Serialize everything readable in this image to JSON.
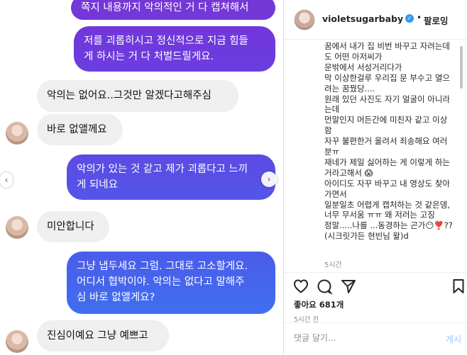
{
  "chat": {
    "messages": [
      {
        "side": "out",
        "lines": [
          "쪽지 내용까지 악의적인 거 다 캡쳐해서"
        ]
      },
      {
        "side": "out",
        "lines": [
          "저를 괴롭히시고 정신적으로 지금 힘들",
          "게 하시는 거 다 처벌드릴게요."
        ]
      },
      {
        "side": "in",
        "lines": [
          "악의는 없어요..그것만 알겠다고해주심"
        ]
      },
      {
        "side": "in",
        "lines": [
          "바로 없앨께요"
        ]
      },
      {
        "side": "out",
        "lines": [
          "악의가 있는 것 같고 제가 괴롭다고 느끼",
          "게 되네요"
        ]
      },
      {
        "side": "in",
        "lines": [
          "미안합니다"
        ]
      },
      {
        "side": "out",
        "lines": [
          "그냥 냅두세요 그럼. 그대로 고소할게요.",
          "어디서 협박이야. 악의는 없다고 말해주",
          "심 바로 없앨게요?"
        ]
      },
      {
        "side": "in",
        "lines": [
          "진심이예요 그냥 예쁘고"
        ]
      }
    ],
    "colors": {
      "gradient_top": "#6a36e0",
      "gradient_bottom": "#3f6ff0",
      "incoming": "#efefef"
    }
  },
  "post": {
    "username": "violetsugarbaby",
    "separator": "•",
    "follow_label": "팔로잉",
    "caption_lines": [
      "꿈에서 내가 집 비번 바꾸고 자려는데",
      "도 어떤 아저씨가",
      "문밖에서 서성거리다가",
      "막 이상한걸루 우리집 문 부수고 열으",
      "려는 꿈꿨당....",
      "원래 있던 사진도 자기 얼굴이 아니라",
      "는데",
      "먼말인지 머든간에 미친자 같고 이상",
      "함",
      "자꾸 불편한거 올려서 죄송해요 여러",
      "분ㅠ",
      "재네가 제일 싫어하는 게 이렇게 하는",
      "거라고해서 😱",
      "아이디도 자꾸 바꾸고 내 영상도 찾아",
      "가면서",
      "일분일초 어렵게 캡처하는 것 같은뎅,",
      "너무 무서움 ㅠㅠ 왜 저러는 고징",
      "정말.....나를 ...동경하는 곤가😶❣️??",
      "(시크릿가든 현빈님 왈)d"
    ],
    "caption_time": "5시간",
    "likes": "좋아요 681개",
    "post_time": "5시간 전",
    "comment_placeholder": "댓글 달기...",
    "post_label": "게시",
    "icons": [
      "heart-icon",
      "comment-icon",
      "share-icon",
      "bookmark-icon",
      "verified-icon"
    ]
  }
}
